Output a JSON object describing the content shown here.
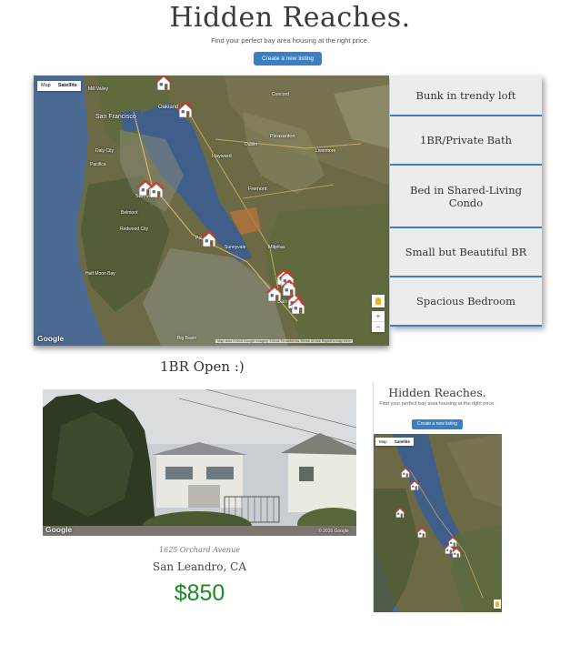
{
  "header": {
    "title": "Hidden Reaches.",
    "subtitle": "Find your perfect bay area housing at the right price.",
    "create_button": "Create a new listing"
  },
  "map": {
    "type_control": {
      "map_label": "Map",
      "satellite_label": "Satellite",
      "selected": "Satellite"
    },
    "logo": "Google",
    "attribution": "Map data ©2016 Google Imagery ©2016 TerraMetrics   Terms of Use   Report a map error",
    "zoom_in": "+",
    "zoom_out": "−",
    "place_labels": [
      "San Francisco",
      "Oakland",
      "Daly City",
      "San Mateo",
      "Redwood City",
      "Hayward",
      "Fremont",
      "Pleasanton",
      "Palo Alto",
      "Milpitas",
      "Sunnyvale",
      "San Jose",
      "Half Moon Bay",
      "Pacifica",
      "Big Basin",
      "Mill Valley",
      "Concord",
      "Dublin",
      "Livermore",
      "Belmont"
    ],
    "marker_icon": "house-marker-icon",
    "marker_count": 11
  },
  "listings": [
    {
      "title": "Bunk in trendy loft"
    },
    {
      "title": "1BR/Private Bath"
    },
    {
      "title": "Bed in Shared-Living Condo"
    },
    {
      "title": "Small but Beautiful BR"
    },
    {
      "title": "Spacious Bedroom"
    }
  ],
  "detail": {
    "title": "1BR Open :)",
    "photo_logo": "Google",
    "photo_copyright": "© 2016 Google",
    "address": "1625 Orchard Avenue",
    "city": "San Leandro, CA",
    "price": "$850"
  },
  "mobile_preview": {
    "title": "Hidden Reaches.",
    "subtitle": "Find your perfect bay area housing at the right price.",
    "create_button": "Create a new listing",
    "map_label": "Map",
    "satellite_label": "Satellite",
    "marker_count": 7
  },
  "colors": {
    "accent": "#3a7fc1",
    "price": "#1f8a23",
    "panel_bg": "#ececec",
    "water": "#3f5f8a",
    "land": "#6b6a45"
  }
}
